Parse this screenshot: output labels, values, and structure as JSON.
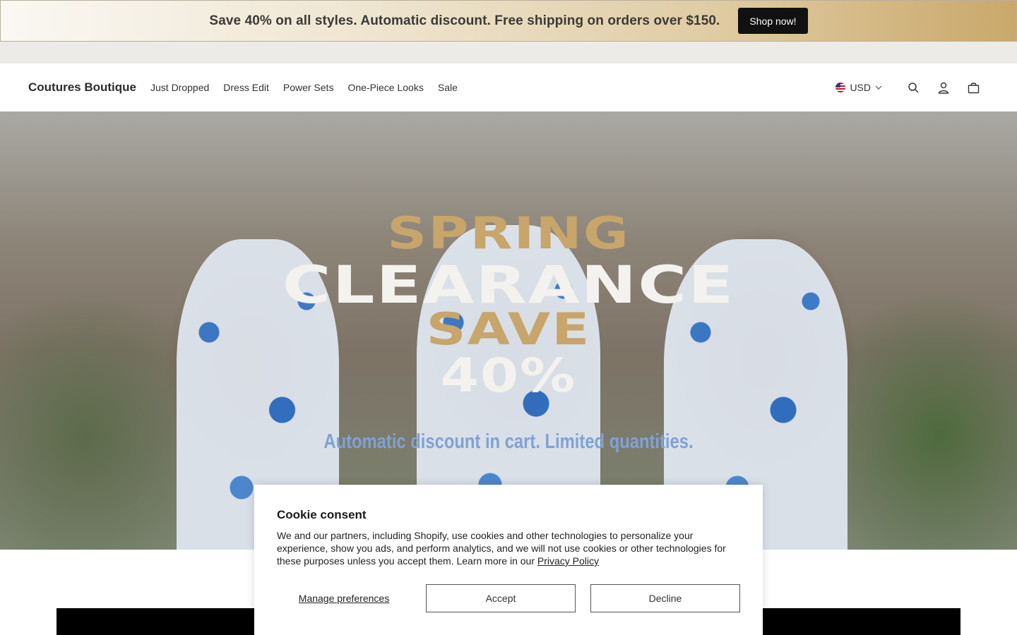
{
  "announcement": {
    "text": "Save 40% on all styles. Automatic discount. Free shipping on orders over $150.",
    "button_label": "Shop now!"
  },
  "header": {
    "logo": "Coutures Boutique",
    "nav": [
      "Just Dropped",
      "Dress Edit",
      "Power Sets",
      "One-Piece Looks",
      "Sale"
    ],
    "currency": "USD",
    "icons": [
      "us-flag-icon",
      "chevron-down-icon",
      "search-icon",
      "account-icon",
      "cart-icon"
    ]
  },
  "hero": {
    "line1": "SPRING",
    "line2": "CLEARANCE",
    "line3": "SAVE",
    "line4": "40%",
    "subtitle": "Automatic discount in cart. Limited quantities."
  },
  "cookie": {
    "title": "Cookie consent",
    "body": "We and our partners, including Shopify, use cookies and other technologies to personalize your experience, show you ads, and perform analytics, and we will not use cookies or other technologies for these purposes unless you accept them. Learn more in our",
    "link": "Privacy Policy",
    "manage_label": "Manage preferences",
    "accept_label": "Accept",
    "decline_label": "Decline"
  },
  "colors": {
    "accent_gold": "#c7a56b",
    "button_dark": "#111111",
    "hero_blue_text": "#7ea2d6"
  }
}
